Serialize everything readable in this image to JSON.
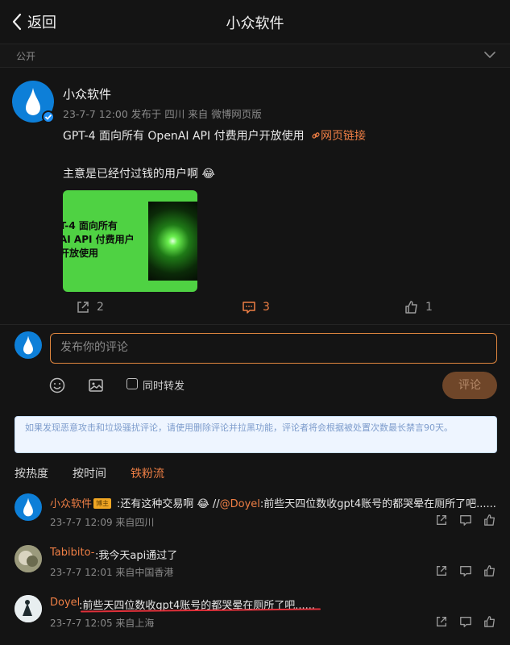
{
  "header": {
    "back_label": "返回",
    "title": "小众软件"
  },
  "visibility": {
    "label": "公开"
  },
  "post": {
    "author": "小众软件",
    "meta": "23-7-7 12:00  发布于 四川  来自 微博网页版",
    "text_line1": "GPT-4 面向所有 OpenAI API 付费用户开放使用",
    "link_label": "网页链接",
    "text_line2": "主意是已经付过钱的用户啊 😂",
    "image": {
      "line1": "T-4 面向所有",
      "line2": "AI API 付费用户",
      "line3": "开放使用",
      "bg_color": "#4fd243"
    },
    "actions": {
      "repost_count": "2",
      "comment_count": "3",
      "like_count": "1"
    }
  },
  "composer": {
    "placeholder": "发布你的评论",
    "repost_label": "同时转发",
    "submit_label": "评论"
  },
  "notice": "如果发现恶意攻击和垃圾骚扰评论，请使用删除评论并拉黑功能，评论者将会根据被处置次数最长禁言90天。",
  "sort_tabs": [
    "按热度",
    "按时间",
    "铁粉流"
  ],
  "comments": [
    {
      "name": "小众软件",
      "badge": "博主",
      "text_pre": ":还有这种交易啊 😂 //",
      "mention": "@Doyel",
      "text_post": ":前些天四位数收gpt4账号的都哭晕在厕所了吧......",
      "meta": "23-7-7 12:09  来自四川"
    },
    {
      "name": "Tabibito-",
      "text": ":我今天api通过了",
      "meta": "23-7-7 12:01  来自中国香港"
    },
    {
      "name": "Doyel",
      "text": ":前些天四位数收gpt4账号的都哭晕在厕所了吧......",
      "meta": "23-7-7 12:05  来自上海"
    }
  ],
  "colors": {
    "accent": "#ef7f45",
    "background": "#141414",
    "avatar_blue": "#0d7fd8"
  }
}
